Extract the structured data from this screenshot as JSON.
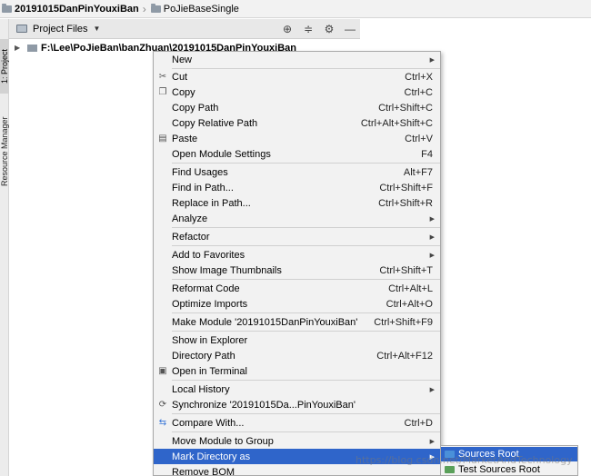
{
  "breadcrumb": {
    "project": "20191015DanPinYouxiBan",
    "module": "PoJieBaseSingle"
  },
  "tool_windows": {
    "project_tab": "1: Project",
    "resource_tab": "Resource Manager"
  },
  "project_panel": {
    "title": "Project Files",
    "tree_root": "F:\\Lee\\PoJieBan\\banZhuan\\20191015DanPinYouxiBan"
  },
  "context_menu": {
    "items": [
      {
        "label": "New",
        "shortcut": "",
        "submenu": true
      },
      {
        "label": "Cut",
        "shortcut": "Ctrl+X",
        "icon": "scissors-icon"
      },
      {
        "label": "Copy",
        "shortcut": "Ctrl+C",
        "icon": "copy-icon"
      },
      {
        "label": "Copy Path",
        "shortcut": "Ctrl+Shift+C"
      },
      {
        "label": "Copy Relative Path",
        "shortcut": "Ctrl+Alt+Shift+C"
      },
      {
        "label": "Paste",
        "shortcut": "Ctrl+V",
        "icon": "clipboard-icon"
      },
      {
        "label": "Open Module Settings",
        "shortcut": "F4"
      },
      {
        "label": "Find Usages",
        "shortcut": "Alt+F7"
      },
      {
        "label": "Find in Path...",
        "shortcut": "Ctrl+Shift+F"
      },
      {
        "label": "Replace in Path...",
        "shortcut": "Ctrl+Shift+R"
      },
      {
        "label": "Analyze",
        "shortcut": "",
        "submenu": true
      },
      {
        "label": "Refactor",
        "shortcut": "",
        "submenu": true
      },
      {
        "label": "Add to Favorites",
        "shortcut": "",
        "submenu": true
      },
      {
        "label": "Show Image Thumbnails",
        "shortcut": "Ctrl+Shift+T"
      },
      {
        "label": "Reformat Code",
        "shortcut": "Ctrl+Alt+L"
      },
      {
        "label": "Optimize Imports",
        "shortcut": "Ctrl+Alt+O"
      },
      {
        "label": "Make Module '20191015DanPinYouxiBan'",
        "shortcut": "Ctrl+Shift+F9"
      },
      {
        "label": "Show in Explorer",
        "shortcut": ""
      },
      {
        "label": "Directory Path",
        "shortcut": "Ctrl+Alt+F12"
      },
      {
        "label": "Open in Terminal",
        "shortcut": "",
        "icon": "terminal-icon"
      },
      {
        "label": "Local History",
        "shortcut": "",
        "submenu": true
      },
      {
        "label": "Synchronize '20191015Da...PinYouxiBan'",
        "shortcut": "",
        "icon": "sync-icon"
      },
      {
        "label": "Compare With...",
        "shortcut": "Ctrl+D",
        "icon": "compare-icon"
      },
      {
        "label": "Move Module to Group",
        "shortcut": "",
        "submenu": true
      },
      {
        "label": "Mark Directory as",
        "shortcut": "",
        "submenu": true,
        "selected": true
      },
      {
        "label": "Remove BOM",
        "shortcut": ""
      }
    ]
  },
  "mark_directory_submenu": {
    "items": [
      {
        "label": "Sources Root",
        "selected": true,
        "color": "#4a90d9"
      },
      {
        "label": "Test Sources Root",
        "color": "#5aa05a"
      }
    ]
  },
  "watermark": "https://blog.csdn.net/MarketAndTechnology",
  "colors": {
    "selection": "#2f65ca",
    "menu_bg": "#f2f2f2"
  }
}
